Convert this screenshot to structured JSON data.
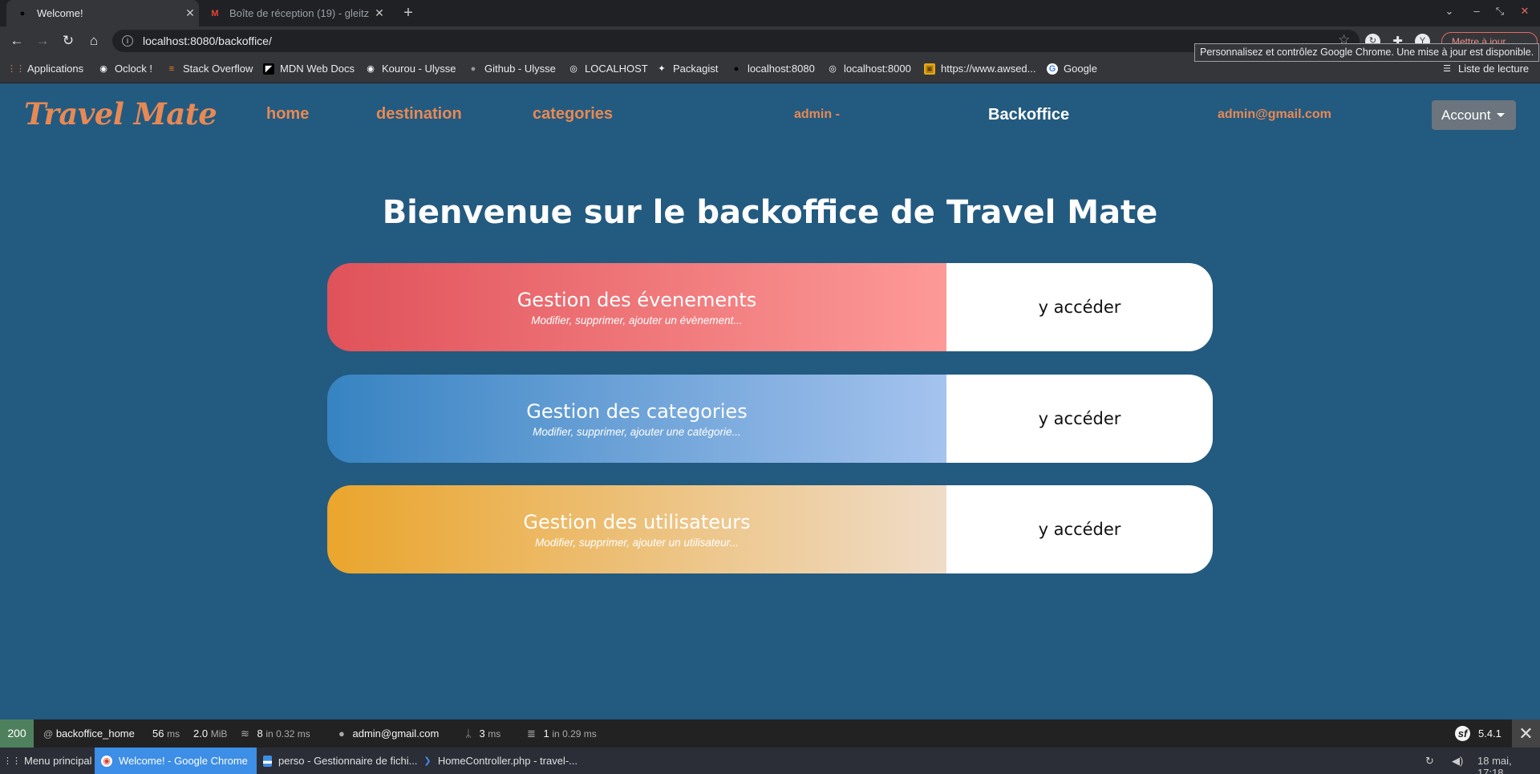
{
  "browser": {
    "tabs": [
      {
        "title": "Welcome!",
        "active": true
      },
      {
        "title": "Boîte de réception (19) - gleitz",
        "active": false
      }
    ],
    "url": "localhost:8080/backoffice/",
    "update_button": "Mettre à jour",
    "tooltip": "Personnalisez et contrôlez Google Chrome. Une mise à jour est disponible.",
    "bookmarks": [
      "Applications",
      "Oclock !",
      "Stack Overflow",
      "MDN Web Docs",
      "Kourou - Ulysse",
      "Github - Ulysse",
      "LOCALHOST",
      "Packagist",
      "localhost:8080",
      "localhost:8000",
      "https://www.awsed...",
      "Google"
    ],
    "reading_list": "Liste de lecture"
  },
  "site": {
    "logo": "Travel Mate",
    "nav": {
      "home": "home",
      "destination": "destination",
      "categories": "categories",
      "admin": "admin -",
      "backoffice": "Backoffice",
      "email": "admin@gmail.com",
      "account": "Account"
    },
    "title": "Bienvenue sur le backoffice de Travel Mate",
    "cards": [
      {
        "title": "Gestion des évenements",
        "subtitle": "Modifier, supprimer, ajouter un évènement...",
        "action": "y accéder"
      },
      {
        "title": "Gestion des categories",
        "subtitle": "Modifier, supprimer, ajouter une catégorie...",
        "action": "y accéder"
      },
      {
        "title": "Gestion des utilisateurs",
        "subtitle": "Modifier, supprimer, ajouter un utilisateur...",
        "action": "y accéder"
      }
    ]
  },
  "debug_bar": {
    "status": "200",
    "route_prefix": "@",
    "route": "backoffice_home",
    "time": "56",
    "time_unit": "ms",
    "memory": "2.0",
    "memory_unit": "MiB",
    "forms": "8",
    "forms_detail": "in 0.32 ms",
    "user": "admin@gmail.com",
    "twig": "3",
    "twig_unit": "ms",
    "db": "1",
    "db_detail": "in 0.29 ms",
    "version": "5.4.1"
  },
  "taskbar": {
    "menu": "Menu principal",
    "items": [
      "Welcome! - Google Chrome",
      "perso - Gestionnaire de fichi...",
      "HomeController.php - travel-..."
    ],
    "clock": "18 mai, 17:18"
  },
  "colors": {
    "page_bg": "#235a80",
    "accent_orange": "#e88953",
    "card1_gradient": [
      "#e0525a",
      "#fd9a98"
    ],
    "card2_gradient": [
      "#3783c2",
      "#a5c3ee"
    ],
    "card3_gradient": [
      "#eaa52c",
      "#efdcc8"
    ]
  }
}
